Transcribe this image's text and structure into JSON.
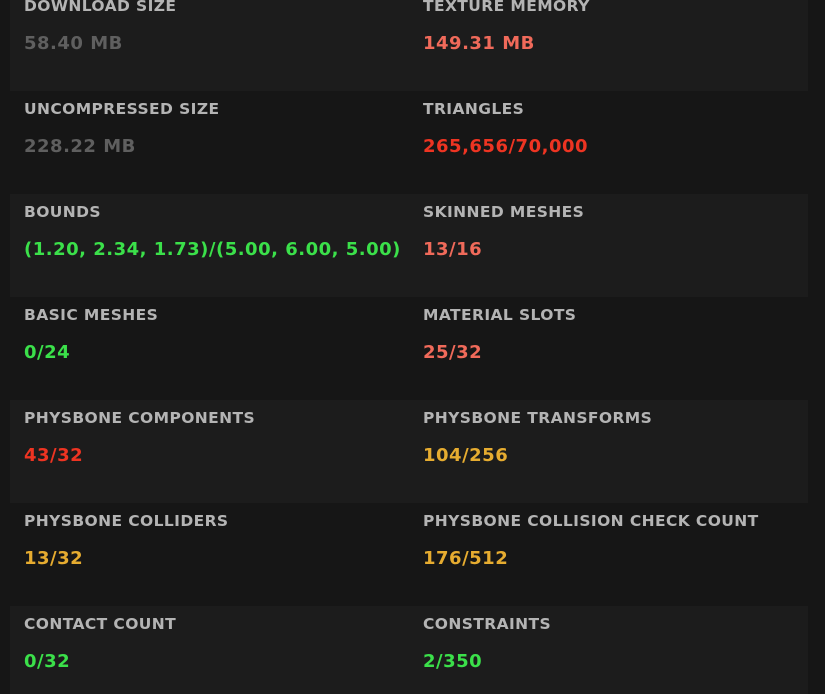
{
  "colors": {
    "gray": "#5f5f5f",
    "green": "#3be04a",
    "salmon": "#f06a5a",
    "red": "#ee3422",
    "orange": "#e6ac30",
    "label": "#b4b4b4"
  },
  "stats": [
    {
      "label": "DOWNLOAD SIZE",
      "value": "58.40 MB",
      "status": "gray"
    },
    {
      "label": "TEXTURE MEMORY",
      "value": "149.31 MB",
      "status": "salmon"
    },
    {
      "label": "UNCOMPRESSED SIZE",
      "value": "228.22 MB",
      "status": "gray"
    },
    {
      "label": "TRIANGLES",
      "value": "265,656/70,000",
      "status": "red"
    },
    {
      "label": "BOUNDS",
      "value": "(1.20, 2.34, 1.73)/(5.00, 6.00, 5.00)",
      "status": "green"
    },
    {
      "label": "SKINNED MESHES",
      "value": "13/16",
      "status": "salmon"
    },
    {
      "label": "BASIC MESHES",
      "value": "0/24",
      "status": "green"
    },
    {
      "label": "MATERIAL SLOTS",
      "value": "25/32",
      "status": "salmon"
    },
    {
      "label": "PHYSBONE COMPONENTS",
      "value": "43/32",
      "status": "red"
    },
    {
      "label": "PHYSBONE TRANSFORMS",
      "value": "104/256",
      "status": "orange"
    },
    {
      "label": "PHYSBONE COLLIDERS",
      "value": "13/32",
      "status": "orange"
    },
    {
      "label": "PHYSBONE COLLISION CHECK COUNT",
      "value": "176/512",
      "status": "orange"
    },
    {
      "label": "CONTACT COUNT",
      "value": "0/32",
      "status": "green"
    },
    {
      "label": "CONSTRAINTS",
      "value": "2/350",
      "status": "green"
    }
  ]
}
